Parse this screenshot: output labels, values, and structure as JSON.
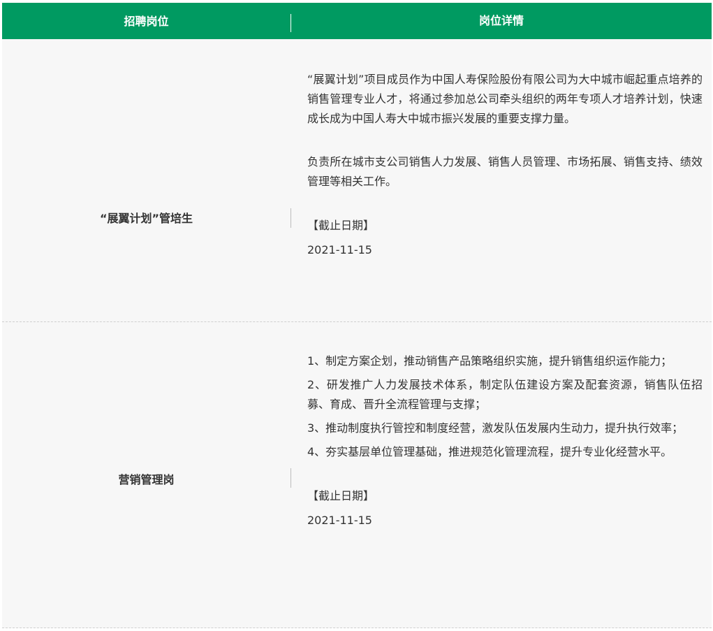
{
  "header": {
    "position_label": "招聘岗位",
    "detail_label": "岗位详情"
  },
  "rows": [
    {
      "position": "“展翼计划”管培生",
      "paragraphs": [
        "“展翼计划”项目成员作为中国人寿保险股份有限公司为大中城市崛起重点培养的销售管理专业人才，将通过参加总公司牵头组织的两年专项人才培养计划，快速成长成为中国人寿大中城市振兴发展的重要支撑力量。",
        "负责所在城市支公司销售人力发展、销售人员管理、市场拓展、销售支持、绩效管理等相关工作。"
      ],
      "deadline_label": "【截止日期】",
      "deadline_date": "2021-11-15"
    },
    {
      "position": "营销管理岗",
      "items": [
        "1、制定方案企划，推动销售产品策略组织实施，提升销售组织运作能力；",
        "2、研发推广人力发展技术体系，制定队伍建设方案及配套资源，销售队伍招募、育成、晋升全流程管理与支撑；",
        "3、推动制度执行管控和制度经营，激发队伍发展内生动力，提升执行效率；",
        "4、夯实基层单位管理基础，推进规范化管理流程，提升专业化经营水平。"
      ],
      "deadline_label": "【截止日期】",
      "deadline_date": "2021-11-15"
    }
  ],
  "colors": {
    "header_bg": "#009a61",
    "row_bg": "#f7f7f7",
    "text": "#333333"
  }
}
